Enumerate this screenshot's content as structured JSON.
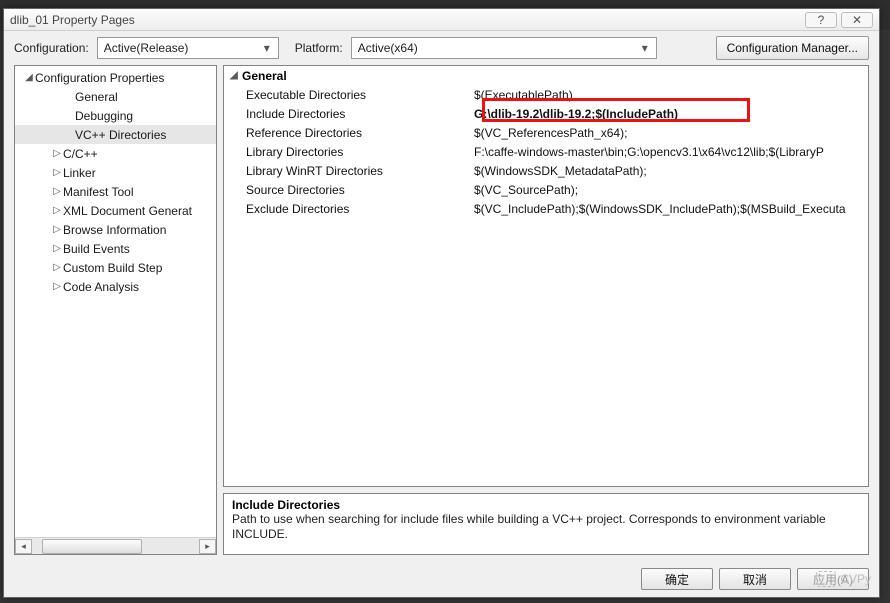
{
  "window": {
    "title": "dlib_01 Property Pages",
    "help_icon": "?",
    "close_icon": "✕"
  },
  "top": {
    "config_label": "Configuration:",
    "config_value": "Active(Release)",
    "platform_label": "Platform:",
    "platform_value": "Active(x64)",
    "config_mgr_label": "Configuration Manager..."
  },
  "tree": {
    "root": "Configuration Properties",
    "items": [
      {
        "label": "General",
        "indent": 48,
        "arrow": ""
      },
      {
        "label": "Debugging",
        "indent": 48,
        "arrow": ""
      },
      {
        "label": "VC++ Directories",
        "indent": 48,
        "arrow": "",
        "selected": true
      },
      {
        "label": "C/C++",
        "indent": 36,
        "arrow": "▷"
      },
      {
        "label": "Linker",
        "indent": 36,
        "arrow": "▷"
      },
      {
        "label": "Manifest Tool",
        "indent": 36,
        "arrow": "▷"
      },
      {
        "label": "XML Document Generat",
        "indent": 36,
        "arrow": "▷"
      },
      {
        "label": "Browse Information",
        "indent": 36,
        "arrow": "▷"
      },
      {
        "label": "Build Events",
        "indent": 36,
        "arrow": "▷"
      },
      {
        "label": "Custom Build Step",
        "indent": 36,
        "arrow": "▷"
      },
      {
        "label": "Code Analysis",
        "indent": 36,
        "arrow": "▷"
      }
    ]
  },
  "grid": {
    "group": "General",
    "rows": [
      {
        "name": "Executable Directories",
        "value": "$(ExecutablePath)"
      },
      {
        "name": "Include Directories",
        "value": "G:\\dlib-19.2\\dlib-19.2;$(IncludePath)",
        "highlight": true
      },
      {
        "name": "Reference Directories",
        "value": "$(VC_ReferencesPath_x64);"
      },
      {
        "name": "Library Directories",
        "value": "F:\\caffe-windows-master\\bin;G:\\opencv3.1\\x64\\vc12\\lib;$(LibraryP"
      },
      {
        "name": "Library WinRT Directories",
        "value": "$(WindowsSDK_MetadataPath);"
      },
      {
        "name": "Source Directories",
        "value": "$(VC_SourcePath);"
      },
      {
        "name": "Exclude Directories",
        "value": "$(VC_IncludePath);$(WindowsSDK_IncludePath);$(MSBuild_Executa"
      }
    ]
  },
  "desc": {
    "title": "Include Directories",
    "body": "Path to use when searching for include files while building a VC++ project.  Corresponds to environment variable INCLUDE."
  },
  "buttons": {
    "ok": "确定",
    "cancel": "取消",
    "apply": "应用(A)"
  },
  "watermark": "CVPy"
}
